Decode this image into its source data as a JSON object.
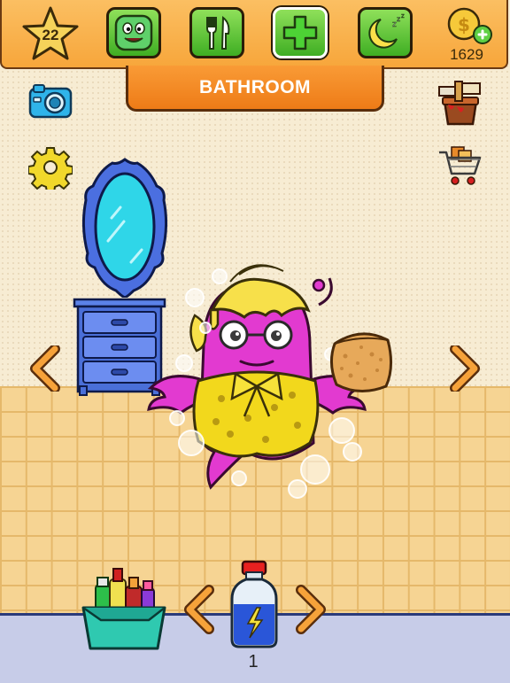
{
  "top_bar": {
    "level": "22",
    "coins": "1629",
    "buttons": [
      {
        "name": "character-button",
        "icon": "face-icon"
      },
      {
        "name": "food-button",
        "icon": "fork-knife-icon"
      },
      {
        "name": "health-button",
        "icon": "plus-icon",
        "active": true
      },
      {
        "name": "sleep-button",
        "icon": "moon-icon"
      }
    ]
  },
  "room": {
    "title": "BATHROOM"
  },
  "side_buttons": {
    "left": [
      "camera-icon",
      "gear-icon"
    ],
    "right": [
      "paint-bucket-icon",
      "shopping-cart-icon"
    ]
  },
  "item_selector": {
    "current_item": "energy-potion-icon",
    "count": "1"
  },
  "colors": {
    "accent_orange": "#f7a63b",
    "button_green": "#3fae23",
    "pet_pink": "#e23ad0",
    "outfit_yellow": "#f2d81c"
  }
}
